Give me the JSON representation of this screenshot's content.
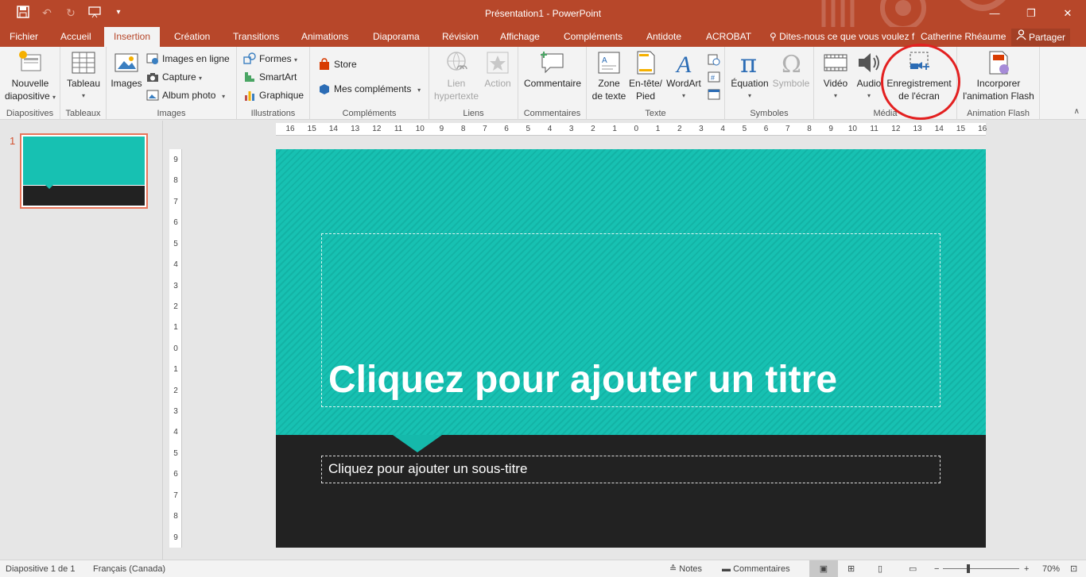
{
  "window": {
    "title": "Présentation1 - PowerPoint",
    "controls": [
      "—",
      "❐",
      "✕"
    ]
  },
  "quick_access": {
    "save_icon": "save-icon",
    "undo_icon": "undo-icon",
    "redo_icon": "redo-icon",
    "start_icon": "slideshow-icon",
    "customize_icon": "customize-icon"
  },
  "tabs": [
    "Fichier",
    "Accueil",
    "Insertion",
    "Création",
    "Transitions",
    "Animations",
    "Diaporama",
    "Révision",
    "Affichage",
    "Compléments",
    "Antidote",
    "ACROBAT"
  ],
  "active_tab": "Insertion",
  "tell_me": "Dites-nous ce que vous voulez f",
  "user": "Catherine Rhéaume",
  "share": "Partager",
  "ribbon": {
    "slides": {
      "label": "Diapositives",
      "new_slide_line1": "Nouvelle",
      "new_slide_line2": "diapositive"
    },
    "tables": {
      "label": "Tableaux",
      "table": "Tableau"
    },
    "images": {
      "label": "Images",
      "images": "Images",
      "online": "Images en ligne",
      "capture": "Capture",
      "album": "Album photo"
    },
    "illustrations": {
      "label": "Illustrations",
      "shapes": "Formes",
      "smartart": "SmartArt",
      "chart": "Graphique"
    },
    "addins": {
      "label": "Compléments",
      "store": "Store",
      "my_addins": "Mes compléments"
    },
    "links": {
      "label": "Liens",
      "link_line1": "Lien",
      "link_line2": "hypertexte",
      "action": "Action"
    },
    "comments": {
      "label": "Commentaires",
      "comment": "Commentaire"
    },
    "text": {
      "label": "Texte",
      "textbox_line1": "Zone",
      "textbox_line2": "de texte",
      "header_line1": "En-tête/",
      "header_line2": "Pied",
      "wordart": "WordArt"
    },
    "symbols": {
      "label": "Symboles",
      "equation": "Équation",
      "symbol": "Symbole"
    },
    "media": {
      "label": "Média",
      "video": "Vidéo",
      "audio": "Audio",
      "record_line1": "Enregistrement",
      "record_line2": "de l'écran"
    },
    "flash": {
      "label": "Animation Flash",
      "embed_line1": "Incorporer",
      "embed_line2": "l'animation Flash"
    }
  },
  "thumbnails": [
    {
      "number": "1"
    }
  ],
  "ruler": {
    "h_ticks": [
      "16",
      "15",
      "14",
      "13",
      "12",
      "11",
      "10",
      "9",
      "8",
      "7",
      "6",
      "5",
      "4",
      "3",
      "2",
      "1",
      "0",
      "1",
      "2",
      "3",
      "4",
      "5",
      "6",
      "7",
      "8",
      "9",
      "10",
      "11",
      "12",
      "13",
      "14",
      "15",
      "16"
    ],
    "v_ticks": [
      "9",
      "8",
      "7",
      "6",
      "5",
      "4",
      "3",
      "2",
      "1",
      "0",
      "1",
      "2",
      "3",
      "4",
      "5",
      "6",
      "7",
      "8",
      "9"
    ]
  },
  "slide": {
    "title_placeholder": "Cliquez pour ajouter un titre",
    "subtitle_placeholder": "Cliquez pour ajouter un sous-titre",
    "colors": {
      "teal": "#17c1b2",
      "dark": "#222222"
    }
  },
  "status": {
    "slide_info": "Diapositive 1 de 1",
    "language": "Français (Canada)",
    "notes": "Notes",
    "comments": "Commentaires",
    "zoom": "70%"
  },
  "colors": {
    "brand": "#b7472a",
    "highlight": "#e32020"
  }
}
